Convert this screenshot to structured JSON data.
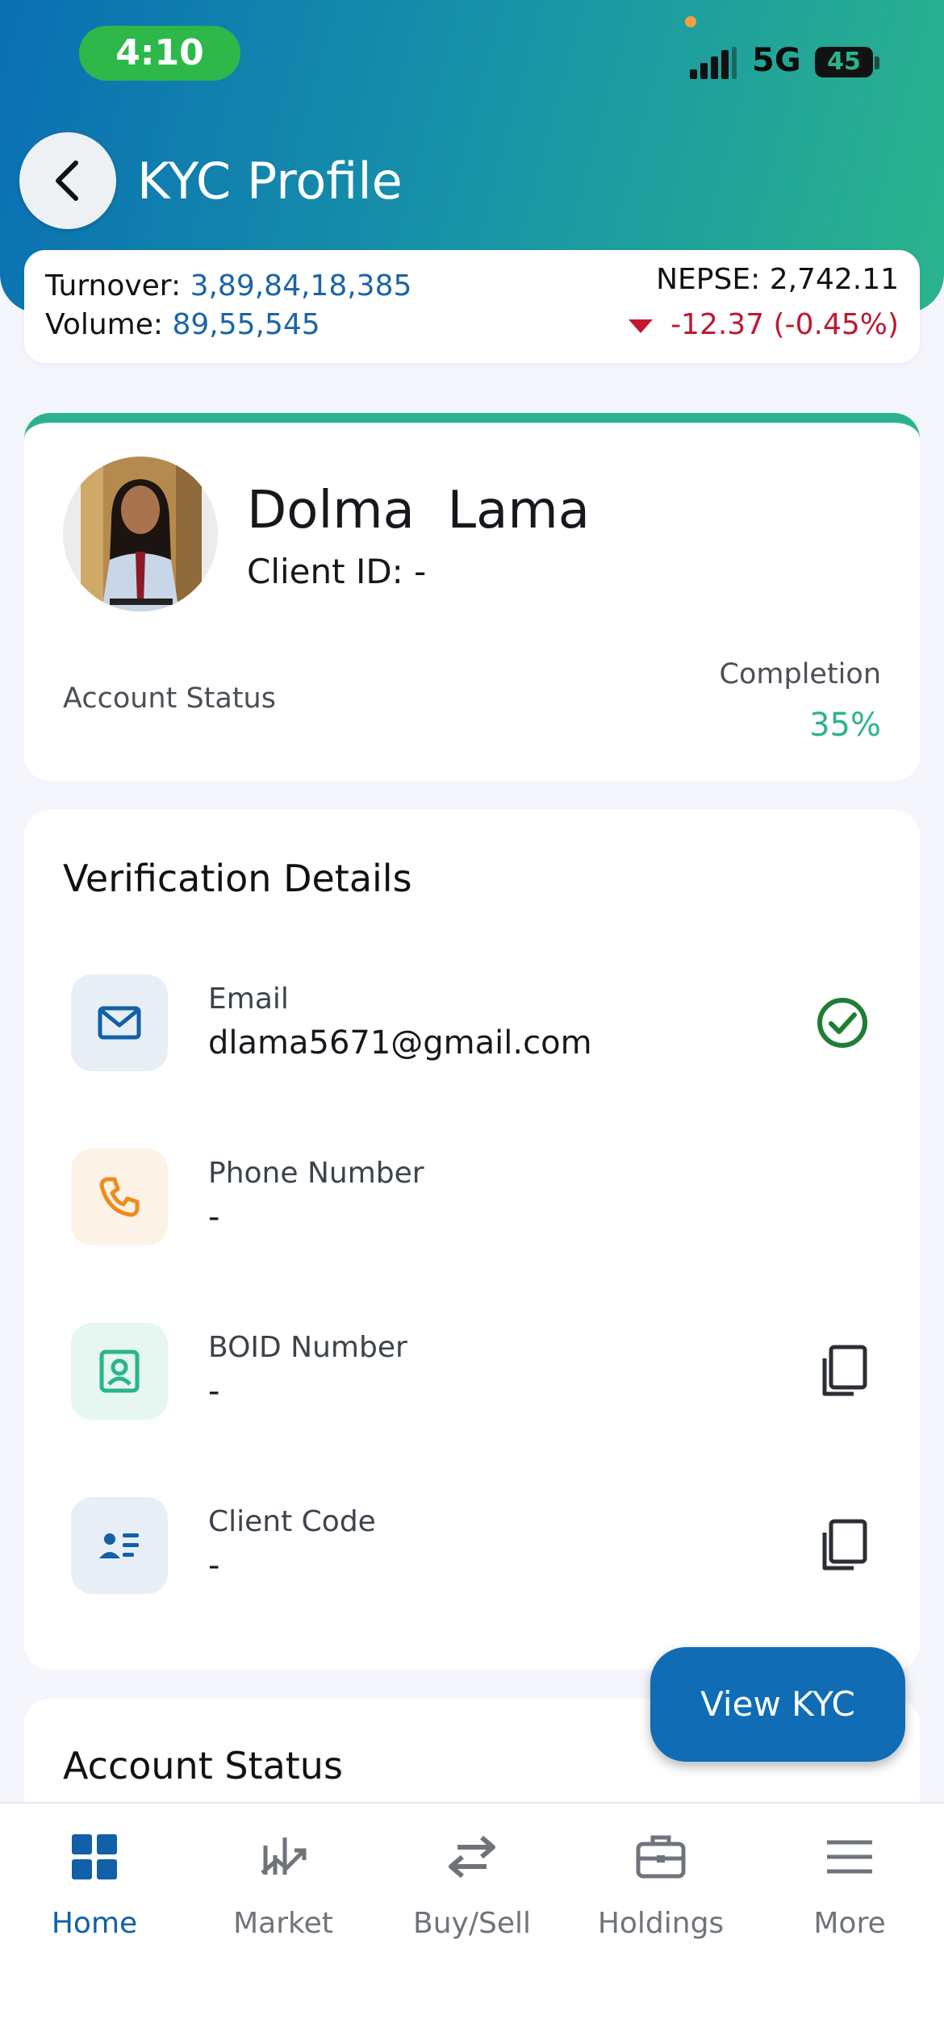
{
  "status_bar": {
    "time": "4:10",
    "network": "5G",
    "battery": "45"
  },
  "header": {
    "title": "KYC Profile"
  },
  "market": {
    "turnover_label": "Turnover:",
    "turnover_value": "3,89,84,18,385",
    "volume_label": "Volume:",
    "volume_value": "89,55,545",
    "nepse_label": "NEPSE:",
    "nepse_value": "2,742.11",
    "change": "-12.37 (-0.45%)"
  },
  "profile": {
    "name": "Dolma  Lama",
    "client_id": "Client ID: -",
    "account_status_label": "Account Status",
    "completion_label": "Completion",
    "completion_value": "35%"
  },
  "verification": {
    "title": "Verification Details",
    "items": [
      {
        "label": "Email",
        "value": "dlama5671@gmail.com",
        "icon": "mail-icon",
        "action": "verified-check-icon"
      },
      {
        "label": "Phone Number",
        "value": "-",
        "icon": "phone-icon",
        "action": ""
      },
      {
        "label": "BOID Number",
        "value": "-",
        "icon": "id-badge-icon",
        "action": "copy-icon"
      },
      {
        "label": "Client Code",
        "value": "-",
        "icon": "contact-card-icon",
        "action": "copy-icon"
      }
    ]
  },
  "account_status_section": {
    "title": "Account Status"
  },
  "fab": {
    "label": "View KYC"
  },
  "nav": {
    "items": [
      {
        "label": "Home",
        "icon": "home-grid-icon",
        "active": true
      },
      {
        "label": "Market",
        "icon": "market-chart-icon",
        "active": false
      },
      {
        "label": "Buy/Sell",
        "icon": "swap-arrows-icon",
        "active": false
      },
      {
        "label": "Holdings",
        "icon": "briefcase-icon",
        "active": false
      },
      {
        "label": "More",
        "icon": "menu-icon",
        "active": false
      }
    ]
  },
  "colors": {
    "accent": "#0f6cb5",
    "success": "#2bb48c",
    "negative": "#c0182f"
  }
}
